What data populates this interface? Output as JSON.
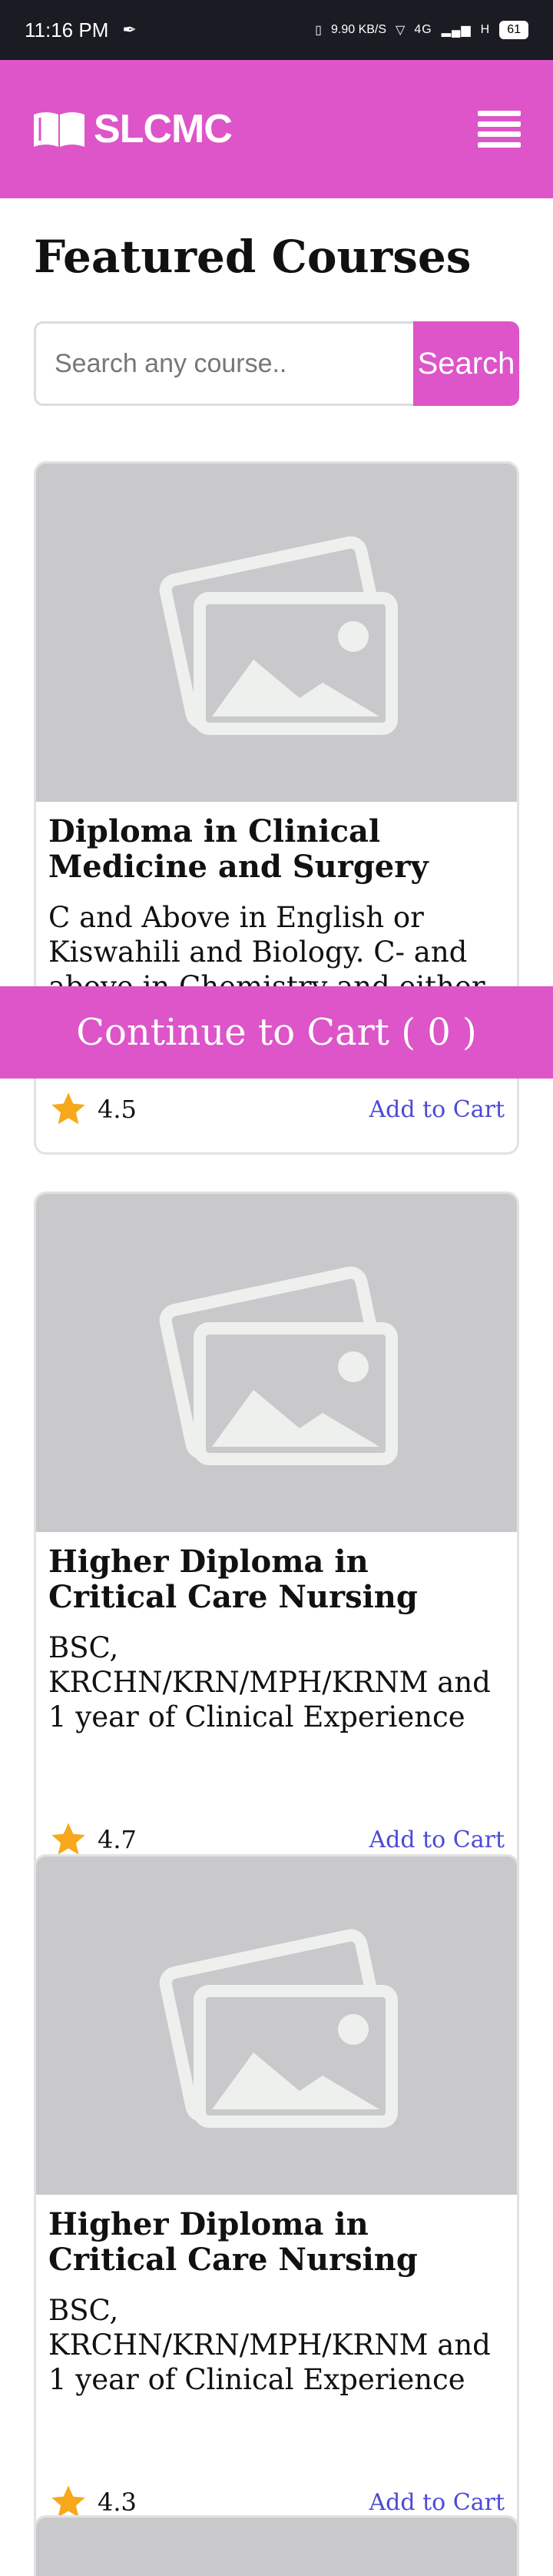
{
  "status_bar": {
    "time": "11:16 PM",
    "speed": "9.90 KB/S",
    "network": "4G",
    "signal2": "H",
    "battery": "61"
  },
  "header": {
    "brand": "SLCMC",
    "logo_icon": "open-book-icon",
    "menu_icon": "hamburger-menu-icon"
  },
  "page": {
    "title": "Featured Courses"
  },
  "search": {
    "placeholder": "Search any course..",
    "button_label": "Search"
  },
  "cart": {
    "label": "Continue to Cart ( 0 )"
  },
  "courses": [
    {
      "title": "Diploma in Clinical Medicine and Surgery",
      "description": "C and Above in English or Kiswahili and Biology. C- and above in Chemistry and either",
      "rating": "4.5",
      "add_label": "Add to Cart"
    },
    {
      "title": "Higher Diploma in Critical Care Nursing",
      "description": "BSC, KRCHN/KRN/MPH/KRNM and 1 year of Clinical Experience",
      "rating": "4.7",
      "add_label": "Add to Cart"
    },
    {
      "title": "Higher Diploma in Critical Care Nursing",
      "description": "BSC, KRCHN/KRN/MPH/KRNM and 1 year of Clinical Experience",
      "rating": "4.3",
      "add_label": "Add to Cart"
    }
  ],
  "colors": {
    "accent": "#dd55c8",
    "link": "#4b4bd6",
    "star": "#f7a81b",
    "placeholder_bg": "#c9c8cb"
  }
}
